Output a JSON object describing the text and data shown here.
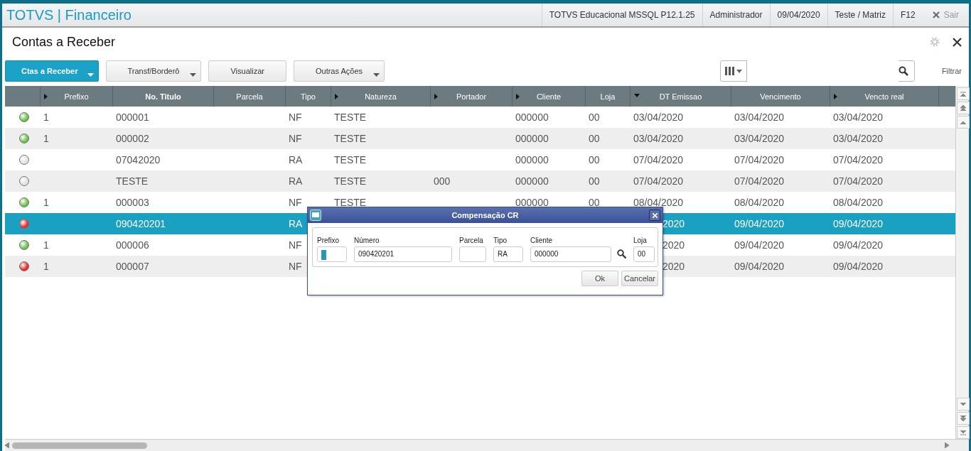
{
  "header": {
    "brand": "TOTVS | Financeiro",
    "info": [
      "TOTVS Educacional MSSQL P12.1.25",
      "Administrador",
      "09/04/2020",
      "Teste / Matriz",
      "F12"
    ],
    "exit": "Sair"
  },
  "page": {
    "title": "Contas a Receber"
  },
  "toolbar": {
    "buttons": [
      {
        "label": "Ctas a Receber",
        "primary": true,
        "dropdown": true
      },
      {
        "label": "Transf/Borderô",
        "primary": false,
        "dropdown": true
      },
      {
        "label": "Visualizar",
        "primary": false,
        "dropdown": false
      },
      {
        "label": "Outras Ações",
        "primary": false,
        "dropdown": true
      }
    ],
    "filter": "Filtrar"
  },
  "table": {
    "columns": [
      {
        "kind": "plain"
      },
      {
        "label": "Prefixo",
        "kind": "expand"
      },
      {
        "label": "No. Titulo",
        "kind": "bold"
      },
      {
        "label": "Parcela",
        "kind": "plain"
      },
      {
        "label": "Tipo",
        "kind": "plain"
      },
      {
        "label": "Natureza",
        "kind": "expand"
      },
      {
        "label": "Portador",
        "kind": "expand"
      },
      {
        "label": "Cliente",
        "kind": "expand"
      },
      {
        "label": "Loja",
        "kind": "plain"
      },
      {
        "label": "DT Emissao",
        "kind": "sorted"
      },
      {
        "label": "Vencimento",
        "kind": "plain"
      },
      {
        "label": "Vencto real",
        "kind": "expand"
      }
    ],
    "rows": [
      {
        "color": "#6cc04a",
        "selected": false,
        "cells": [
          "1",
          "000001",
          "",
          "NF",
          "TESTE",
          "",
          "000000",
          "00",
          "03/04/2020",
          "03/04/2020",
          "03/04/2020"
        ]
      },
      {
        "color": "#6cc04a",
        "selected": false,
        "cells": [
          "1",
          "000002",
          "",
          "NF",
          "TESTE",
          "",
          "000000",
          "00",
          "03/04/2020",
          "03/04/2020",
          "03/04/2020"
        ]
      },
      {
        "color": "#e0e0e0",
        "selected": false,
        "cells": [
          "",
          "07042020",
          "",
          "RA",
          "TESTE",
          "",
          "000000",
          "00",
          "07/04/2020",
          "07/04/2020",
          "07/04/2020"
        ]
      },
      {
        "color": "#e0e0e0",
        "selected": false,
        "cells": [
          "",
          "TESTE",
          "",
          "RA",
          "TESTE",
          "000",
          "000000",
          "00",
          "07/04/2020",
          "07/04/2020",
          "07/04/2020"
        ]
      },
      {
        "color": "#6cc04a",
        "selected": false,
        "cells": [
          "1",
          "000003",
          "",
          "NF",
          "TESTE",
          "",
          "000000",
          "00",
          "08/04/2020",
          "08/04/2020",
          "08/04/2020"
        ]
      },
      {
        "color": "#e8282c",
        "selected": true,
        "cells": [
          "",
          "090420201",
          "",
          "RA",
          "",
          "",
          "",
          "",
          "2020",
          "09/04/2020",
          "09/04/2020"
        ]
      },
      {
        "color": "#6cc04a",
        "selected": false,
        "cells": [
          "1",
          "000006",
          "",
          "NF",
          "",
          "",
          "",
          "",
          "2020",
          "09/04/2020",
          "09/04/2020"
        ]
      },
      {
        "color": "#e8282c",
        "selected": false,
        "cells": [
          "1",
          "000007",
          "",
          "NF",
          "",
          "",
          "",
          "",
          "2020",
          "09/04/2020",
          "09/04/2020"
        ]
      }
    ]
  },
  "dialog": {
    "title": "Compensação CR",
    "fields": [
      {
        "label": "Prefixo",
        "focused": true,
        "lookup": false
      },
      {
        "label": "Número",
        "value": "090420201",
        "focused": false,
        "lookup": false
      },
      {
        "label": "Parcela",
        "focused": false,
        "lookup": false
      },
      {
        "label": "Tipo",
        "value": "RA",
        "focused": false,
        "lookup": false
      },
      {
        "label": "Cliente",
        "value": "000000",
        "focused": false,
        "lookup": true
      },
      {
        "label": "Loja",
        "value": "00",
        "focused": false,
        "lookup": false
      }
    ],
    "buttons": [
      "Ok",
      "Cancelar"
    ]
  }
}
